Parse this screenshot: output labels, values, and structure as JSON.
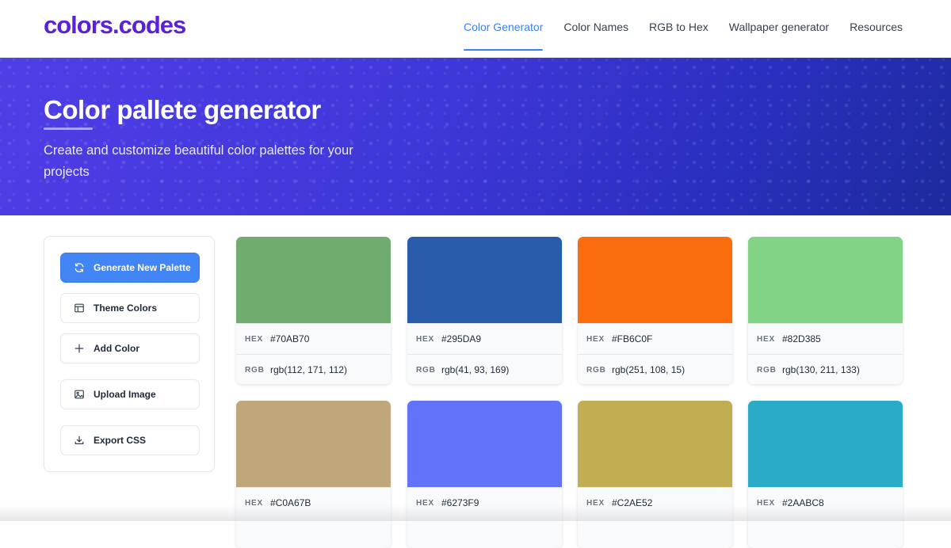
{
  "brand": {
    "logo": "colors.codes",
    "accent": "#5b21d6"
  },
  "nav": [
    {
      "label": "Color Generator",
      "active": true
    },
    {
      "label": "Color Names",
      "active": false
    },
    {
      "label": "RGB to Hex",
      "active": false
    },
    {
      "label": "Wallpaper generator",
      "active": false
    },
    {
      "label": "Resources",
      "active": false
    }
  ],
  "hero": {
    "title": "Color pallete generator",
    "subtitle": "Create and customize beautiful color palettes for your projects"
  },
  "sidebar": {
    "generate": {
      "label": "Generate New Palette",
      "icon": "refresh-icon"
    },
    "theme": {
      "label": "Theme Colors",
      "icon": "layout-icon"
    },
    "add": {
      "label": "Add Color",
      "icon": "plus-icon"
    },
    "upload": {
      "label": "Upload Image",
      "icon": "image-icon"
    },
    "export": {
      "label": "Export CSS",
      "icon": "download-icon"
    }
  },
  "labels": {
    "hex": "HEX",
    "rgb": "RGB"
  },
  "palette": [
    {
      "hex": "#70AB70",
      "rgb": "rgb(112, 171, 112)"
    },
    {
      "hex": "#295DA9",
      "rgb": "rgb(41, 93, 169)"
    },
    {
      "hex": "#FB6C0F",
      "rgb": "rgb(251, 108, 15)"
    },
    {
      "hex": "#82D385",
      "rgb": "rgb(130, 211, 133)"
    },
    {
      "hex": "#C0A67B",
      "rgb": ""
    },
    {
      "hex": "#6273F9",
      "rgb": ""
    },
    {
      "hex": "#C2AE52",
      "rgb": ""
    },
    {
      "hex": "#2AABC8",
      "rgb": ""
    }
  ]
}
